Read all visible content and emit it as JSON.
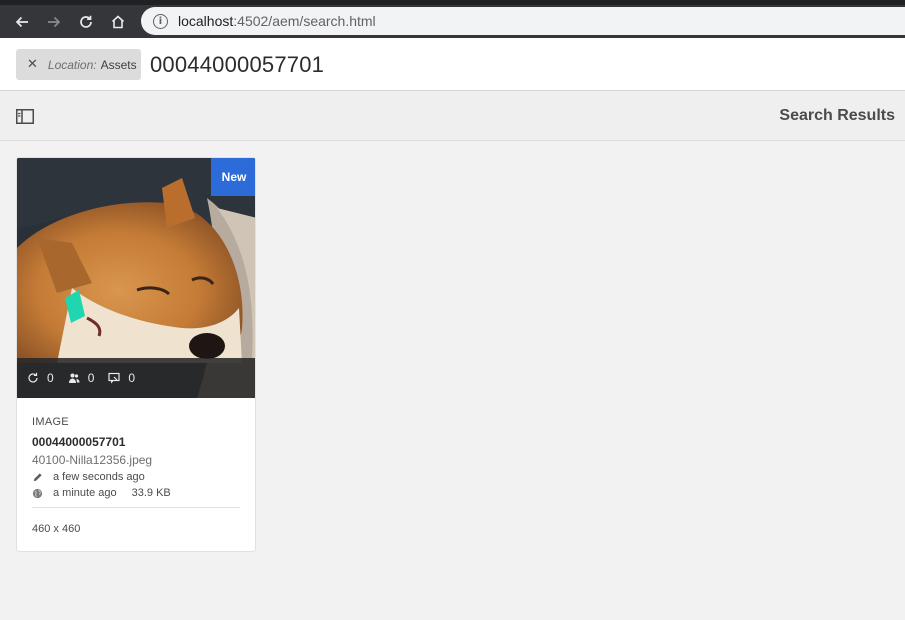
{
  "browser": {
    "url_host": "localhost",
    "url_rest": ":4502/aem/search.html"
  },
  "search": {
    "tag_label": "Location:",
    "tag_value": "Assets",
    "query": "00044000057701"
  },
  "actionbar": {
    "title": "Search Results"
  },
  "card": {
    "badge": "New",
    "stats": [
      {
        "icon": "sync-icon",
        "value": "0"
      },
      {
        "icon": "users-icon",
        "value": "0"
      },
      {
        "icon": "comment-icon",
        "value": "0"
      }
    ],
    "type": "IMAGE",
    "title": "00044000057701",
    "filename": "40100-Nilla12356.jpeg",
    "modified": "a few seconds ago",
    "published": "a minute ago",
    "size": "33.9 KB",
    "dimensions": "460 x 460"
  },
  "colors": {
    "accent": "#2d6bd8",
    "chrome_bg": "#35363a",
    "page_bg": "#f2f2f2"
  }
}
